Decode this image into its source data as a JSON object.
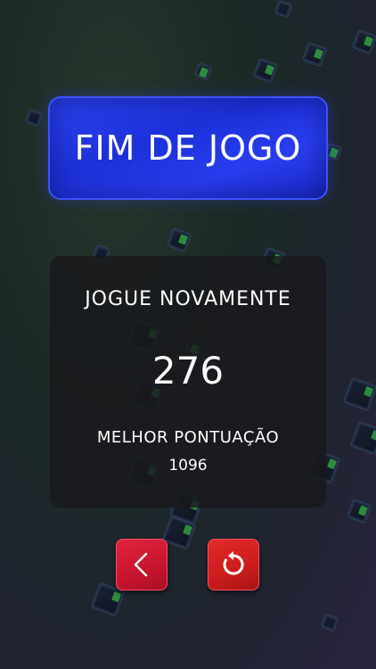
{
  "screen": {
    "title": "FIM DE JOGO",
    "play_again_label": "JOGUE NOVAMENTE",
    "score": "276",
    "best_score_label": "MELHOR PONTUAÇÃO",
    "best_score": "1096"
  },
  "buttons": {
    "back_icon": "chevron-left-icon",
    "restart_icon": "restart-icon"
  },
  "colors": {
    "title_panel": "#2437e6",
    "score_panel": "#19191c",
    "button_red": "#d0192f"
  }
}
